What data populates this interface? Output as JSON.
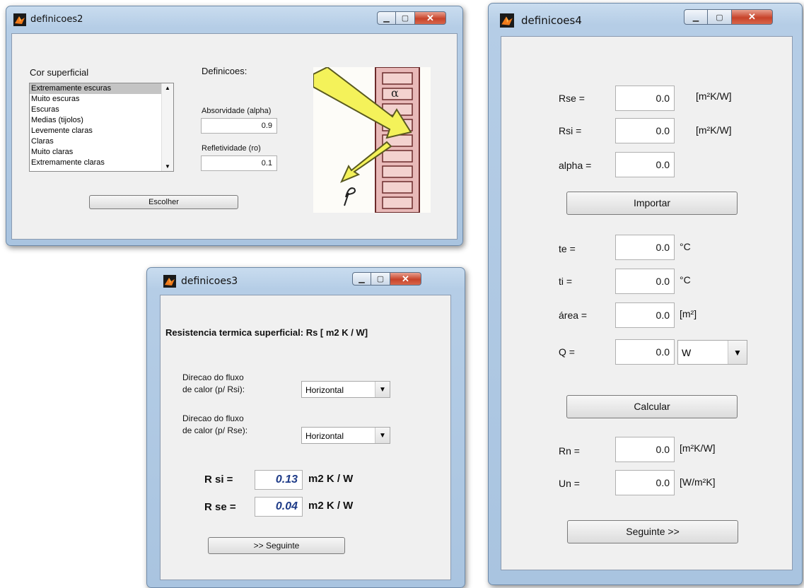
{
  "win2": {
    "title": "definicoes2",
    "cor_label": "Cor superficial",
    "definicoes_label": "Definicoes:",
    "list_items": [
      "Extremamente escuras",
      "Muito escuras",
      "Escuras",
      "Medias (tijolos)",
      "Levemente claras",
      "Claras",
      "Muito claras",
      "Extremamente claras"
    ],
    "absorvidade_label": "Absorvidade (alpha)",
    "absorvidade_value": "0.9",
    "refletividade_label": "Refletividade (ro)",
    "refletividade_value": "0.1",
    "escolher_label": "Escolher"
  },
  "win3": {
    "title": "definicoes3",
    "heading": "Resistencia termica superficial: Rs [ m2 K / W]",
    "dir_rsi_line1": "Direcao do fluxo",
    "dir_rsi_line2": "de calor (p/ Rsi):",
    "dir_rsi_value": "Horizontal",
    "dir_rse_line1": "Direcao do fluxo",
    "dir_rse_line2": "de calor (p/ Rse):",
    "dir_rse_value": "Horizontal",
    "rsi_label": "R si =",
    "rsi_value": "0.13",
    "rsi_unit": "m2 K / W",
    "rse_label": "R se =",
    "rse_value": "0.04",
    "rse_unit": "m2 K / W",
    "seguinte_label": ">> Seguinte"
  },
  "win4": {
    "title": "definicoes4",
    "rse_label": "Rse =",
    "rse_value": "0.0",
    "rse_unit": "[m²K/W]",
    "rsi_label": "Rsi =",
    "rsi_value": "0.0",
    "rsi_unit": "[m²K/W]",
    "alpha_label": "alpha =",
    "alpha_value": "0.0",
    "importar_label": "Importar",
    "te_label": "te =",
    "te_value": "0.0",
    "te_unit": "°C",
    "ti_label": "ti =",
    "ti_value": "0.0",
    "ti_unit": "°C",
    "area_label": "área =",
    "area_value": "0.0",
    "area_unit": "[m²]",
    "q_label": "Q =",
    "q_value": "0.0",
    "q_unit_value": "W",
    "calcular_label": "Calcular",
    "rn_label": "Rn =",
    "rn_value": "0.0",
    "rn_unit": "[m²K/W]",
    "un_label": "Un =",
    "un_value": "0.0",
    "un_unit": "[W/m²K]",
    "seguinte_label": "Seguinte >>"
  },
  "colors": {
    "titlebar": "#b5cde6",
    "client": "#f0f0f0",
    "close": "#c7432a",
    "value_blue": "#1f3c88"
  }
}
